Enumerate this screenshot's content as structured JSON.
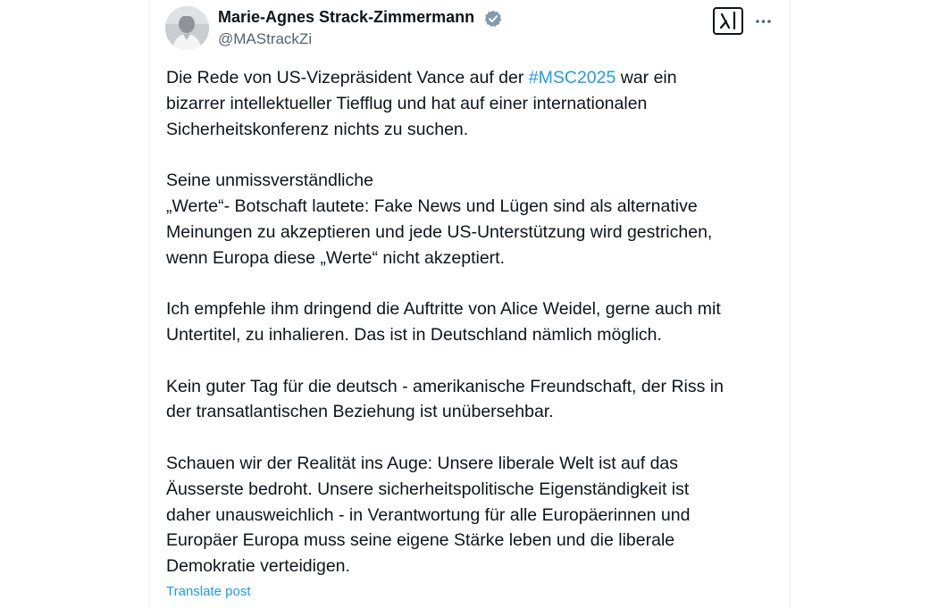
{
  "author": {
    "display_name": "Marie-Agnes Strack-Zimmermann",
    "handle": "@MAStrackZi",
    "verified": true
  },
  "icons": {
    "avatar": "profile-photo",
    "verified": "verified-badge-icon",
    "grok": "grok-icon",
    "more": "more-options-icon"
  },
  "tweet": {
    "p1_before": "Die Rede von US-Vizepräsident Vance auf der ",
    "hashtag": "#MSC2025",
    "p1_after": " war ein",
    "p1_line2": "bizarrer intellektueller Tiefflug und hat auf einer internationalen",
    "p1_line3": "Sicherheitskonferenz nichts zu suchen.",
    "p2_line1": "Seine unmissverständliche",
    "p2_line2": "„Werte“- Botschaft lautete: Fake News und Lügen sind als alternative",
    "p2_line3": "Meinungen zu akzeptieren und jede US-Unterstützung wird gestrichen,",
    "p2_line4": "wenn Europa diese „Werte“ nicht akzeptiert.",
    "p3_line1": "Ich empfehle ihm dringend die Auftritte von Alice Weidel, gerne auch mit",
    "p3_line2": "Untertitel, zu inhalieren. Das ist in Deutschland nämlich möglich.",
    "p4_line1": "Kein guter Tag für die deutsch - amerikanische Freundschaft, der Riss in",
    "p4_line2": "der transatlantischen Beziehung ist unübersehbar.",
    "p5_line1": "Schauen wir der Realität ins Auge: Unsere liberale Welt ist auf das",
    "p5_line2": "Äusserste bedroht. Unsere sicherheitspolitische Eigenständigkeit ist",
    "p5_line3": "daher unausweichlich - in Verantwortung für alle Europäerinnen und",
    "p5_line4": "Europäer Europa muss seine eigene Stärke leben und die  liberale",
    "p5_line5": "Demokratie verteidigen."
  },
  "translate_label": "Translate post",
  "colors": {
    "link": "#1d9bf0",
    "text": "#0f1419",
    "secondary": "#536471",
    "border": "#eff3f4"
  }
}
